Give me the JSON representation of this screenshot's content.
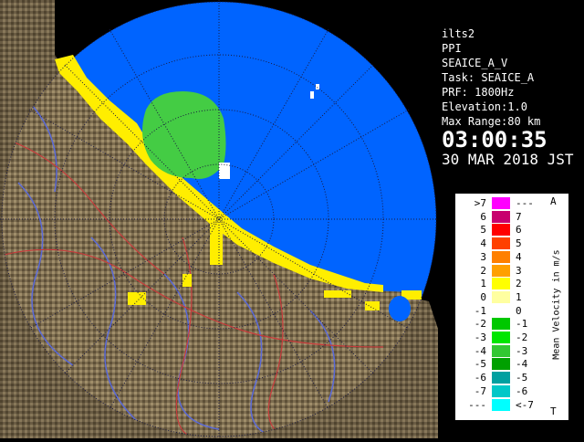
{
  "info": {
    "site": "ilts2",
    "product": "PPI",
    "task_name": "SEAICE_A_V",
    "task": "Task: SEAICE_A",
    "prf": "PRF: 1800Hz",
    "elevation": "Elevation:1.0",
    "max_range": "Max Range:80 km",
    "time": "03:00:35",
    "date": "30 MAR 2018 JST"
  },
  "legend": {
    "title": "Mean Velocity in m/s",
    "top_cap": "A",
    "bottom_cap": "T",
    "rows": [
      {
        "left": ">7",
        "right": "---",
        "color": "#ff00ff"
      },
      {
        "left": "6",
        "right": "7",
        "color": "#c8006e"
      },
      {
        "left": "5",
        "right": "6",
        "color": "#ff0000"
      },
      {
        "left": "4",
        "right": "5",
        "color": "#ff4000"
      },
      {
        "left": "3",
        "right": "4",
        "color": "#ff8000"
      },
      {
        "left": "2",
        "right": "3",
        "color": "#ffa000"
      },
      {
        "left": "1",
        "right": "2",
        "color": "#ffff00"
      },
      {
        "left": "0",
        "right": "1",
        "color": "#ffffa0"
      },
      {
        "left": "-1",
        "right": "0",
        "color": "#ffffff"
      },
      {
        "left": "-2",
        "right": "-1",
        "color": "#00c800"
      },
      {
        "left": "-3",
        "right": "-2",
        "color": "#00e600"
      },
      {
        "left": "-4",
        "right": "-3",
        "color": "#32c832"
      },
      {
        "left": "-5",
        "right": "-4",
        "color": "#00a000"
      },
      {
        "left": "-6",
        "right": "-5",
        "color": "#00a0a0"
      },
      {
        "left": "-7",
        "right": "-6",
        "color": "#00c8c8"
      },
      {
        "left": "---",
        "right": "<-7",
        "color": "#00ffff"
      }
    ]
  },
  "colors": {
    "sea": "#0064ff",
    "out_of_range": "#000000",
    "land": "#8a7a5a",
    "echo_green": "#44cc44",
    "echo_yellow": "#ffee00"
  }
}
